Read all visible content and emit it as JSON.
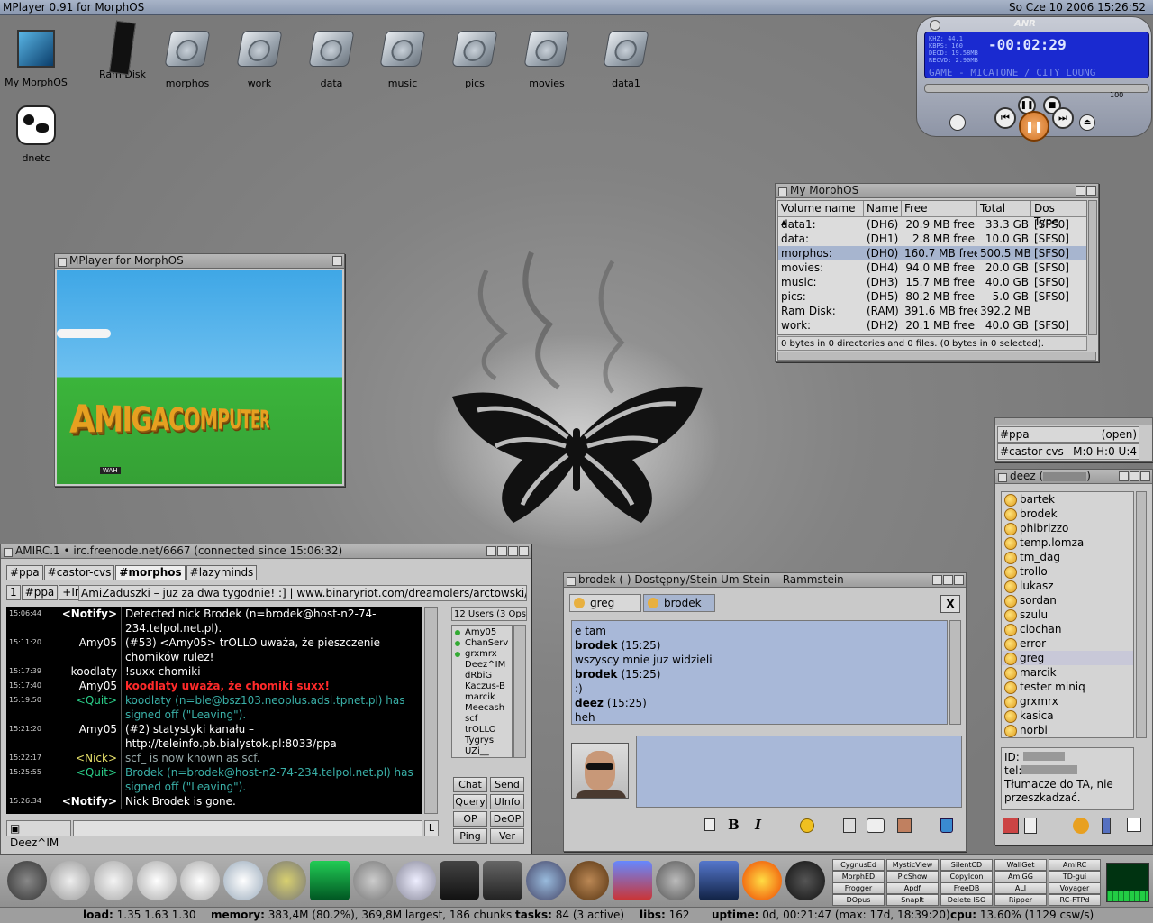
{
  "screen": {
    "title": "MPlayer 0.91 for MorphOS",
    "clock": "So Cze 10 2006  15:26:52"
  },
  "desktop_icons": [
    {
      "label": "My MorphOS"
    },
    {
      "label": "Ram Disk"
    },
    {
      "label": "morphos"
    },
    {
      "label": "work"
    },
    {
      "label": "data"
    },
    {
      "label": "music"
    },
    {
      "label": "pics"
    },
    {
      "label": "movies"
    },
    {
      "label": "data1"
    },
    {
      "label": "dnetc"
    }
  ],
  "player": {
    "logo": "ANR",
    "stats": [
      "KHZ: 44.1",
      "KBPS: 160",
      "DECD: 19.58MB",
      "RECVD: 2.90MB"
    ],
    "time": "-00:02:29",
    "marquee": "GAME - MICATONE / CITY LOUNG",
    "volume": "100"
  },
  "mplayer_window": {
    "title": "MPlayer for MorphOS",
    "video_text": "AMIGACOMPUTER",
    "badge": "WAH"
  },
  "morphos_window": {
    "title": "My MorphOS",
    "headers": [
      "Volume name",
      "Name",
      "Free",
      "Total",
      "Dos Type"
    ],
    "rows": [
      [
        "data1:",
        "(DH6)",
        "20.9 MB free",
        "33.3 GB",
        "[SFS0]"
      ],
      [
        "data:",
        "(DH1)",
        "2.8 MB free",
        "10.0 GB",
        "[SFS0]"
      ],
      [
        "morphos:",
        "(DH0)",
        "160.7 MB free",
        "500.5 MB",
        "[SFS0]"
      ],
      [
        "movies:",
        "(DH4)",
        "94.0 MB free",
        "20.0 GB",
        "[SFS0]"
      ],
      [
        "music:",
        "(DH3)",
        "15.7 MB free",
        "40.0 GB",
        "[SFS0]"
      ],
      [
        "pics:",
        "(DH5)",
        "80.2 MB free",
        "5.0 GB",
        "[SFS0]"
      ],
      [
        "Ram Disk:",
        "(RAM)",
        "391.6 MB free",
        "392.2 MB",
        ""
      ],
      [
        "work:",
        "(DH2)",
        "20.1 MB free",
        "40.0 GB",
        "[SFS0]"
      ]
    ],
    "status": "0 bytes in 0 directories and 0 files. (0 bytes in 0 selected)."
  },
  "channels_panel": {
    "rows": [
      {
        "name": "#ppa",
        "info": "(open)"
      },
      {
        "name": "#castor-cvs",
        "info": "M:0 H:0 U:4"
      }
    ]
  },
  "buddy_window": {
    "title": "deez (",
    "buddies": [
      "bartek",
      "brodek",
      "phibrizzo",
      "temp.lomza",
      "tm_dag",
      "trollo",
      "lukasz",
      "sordan",
      "szulu",
      "ciochan",
      "error",
      "greg",
      "marcik",
      "tester miniq",
      "grxmrx",
      "kasica",
      "norbi"
    ],
    "selected": "greg",
    "info": [
      "ID:",
      "tel:",
      "Tłumacze do TA, nie przeszkadzać."
    ]
  },
  "irc": {
    "title": "AMIRC.1 • irc.freenode.net/6667 (connected since 15:06:32)",
    "tabs": [
      "#ppa",
      "#castor-cvs",
      "#morphos",
      "#lazyminds"
    ],
    "subtabs": [
      "1",
      "#ppa",
      "+Int"
    ],
    "topic": "AmiZaduszki – juz za dwa tygodnie! :] | www.binaryriot.com/dreamolers/arctowski/ | cze",
    "log": [
      {
        "t": "15:06:44",
        "n": "<Notify>",
        "m": "Detected nick Brodek (n=brodek@host-n2-74-234.telpol.net.pl).",
        "c": "white"
      },
      {
        "t": "15:11:20",
        "n": "Amy05",
        "m": "(#53) <Amy05> trOLLO uważa, że pieszczenie chomików rulez!",
        "c": "white"
      },
      {
        "t": "15:17:39",
        "n": "koodlaty",
        "m": "!suxx chomiki",
        "c": "white"
      },
      {
        "t": "15:17:40",
        "n": "Amy05",
        "m": "koodlaty uważa, że chomiki suxx!",
        "c": "red"
      },
      {
        "t": "15:19:50",
        "n": "<Quit>",
        "m": "koodlaty (n=ble@bsz103.neoplus.adsl.tpnet.pl) has signed off (\"Leaving\").",
        "c": "teal"
      },
      {
        "t": "15:21:20",
        "n": "Amy05",
        "m": "(#2) statystyki kanału – http://teleinfo.pb.bialystok.pl:8033/ppa",
        "c": "white"
      },
      {
        "t": "15:22:17",
        "n": "<Nick>",
        "m": "scf_ is now known as scf.",
        "c": "gray"
      },
      {
        "t": "15:25:55",
        "n": "<Quit>",
        "m": "Brodek (n=brodek@host-n2-74-234.telpol.net.pl) has signed off (\"Leaving\").",
        "c": "teal"
      },
      {
        "t": "15:26:34",
        "n": "<Notify>",
        "m": "Nick Brodek is gone.",
        "c": "white"
      }
    ],
    "users_header": "12 Users (3 Ops",
    "users": [
      "Amy05",
      "ChanServ",
      "grxmrx",
      "Deez^IM",
      "dRbiG",
      "Kaczus-B",
      "marcik",
      "Meecash",
      "scf",
      "trOLLO",
      "Tygrys",
      "UZi__"
    ],
    "ops": [
      "Amy05",
      "ChanServ",
      "grxmrx"
    ],
    "buttons": [
      "Chat",
      "Send",
      "Query",
      "UInfo",
      "OP",
      "DeOP",
      "Ping",
      "Ver"
    ],
    "nick": "Deez^IM",
    "input_btn": "L"
  },
  "chat": {
    "title": "brodek (        ) Dostępny/Stein Um Stein – Rammstein",
    "tabs": [
      "greg",
      "brodek"
    ],
    "lines": [
      {
        "text": "e tam",
        "bold": false
      },
      {
        "text": "brodek",
        "time": "(15:25)",
        "bold": true
      },
      {
        "text": "wszyscy mnie juz widzieli",
        "bold": false
      },
      {
        "text": "brodek",
        "time": "(15:25)",
        "bold": true
      },
      {
        "text": ":)",
        "bold": false
      },
      {
        "text": "deez",
        "time": "(15:25)",
        "bold": true
      },
      {
        "text": "heh",
        "bold": false
      }
    ],
    "close": "X"
  },
  "launch_buttons": [
    "CygnusEd",
    "MysticView",
    "SilentCD",
    "WallGet",
    "AmIRC",
    "MorphED",
    "PicShow",
    "Copylcon",
    "AmiGG",
    "TD-gui",
    "Frogger",
    "Apdf",
    "FreeDB",
    "ALI",
    "Voyager",
    "DOpus",
    "SnapIt",
    "Delete ISO",
    "Ripper",
    "RC-FTPd"
  ],
  "status": {
    "load_l": "load:",
    "load": "1.35 1.63 1.30",
    "mem_l": "memory:",
    "mem": "383,4M (80.2%), 369,8M largest, 186 chunks",
    "tasks_l": "tasks:",
    "tasks": "84 (3 active)",
    "libs_l": "libs:",
    "libs": "162",
    "up_l": "uptime:",
    "up": "0d, 00:21:47 (max: 17d, 18:39:20)",
    "cpu_l": "cpu:",
    "cpu": "13.60% (1129 csw/s)"
  }
}
